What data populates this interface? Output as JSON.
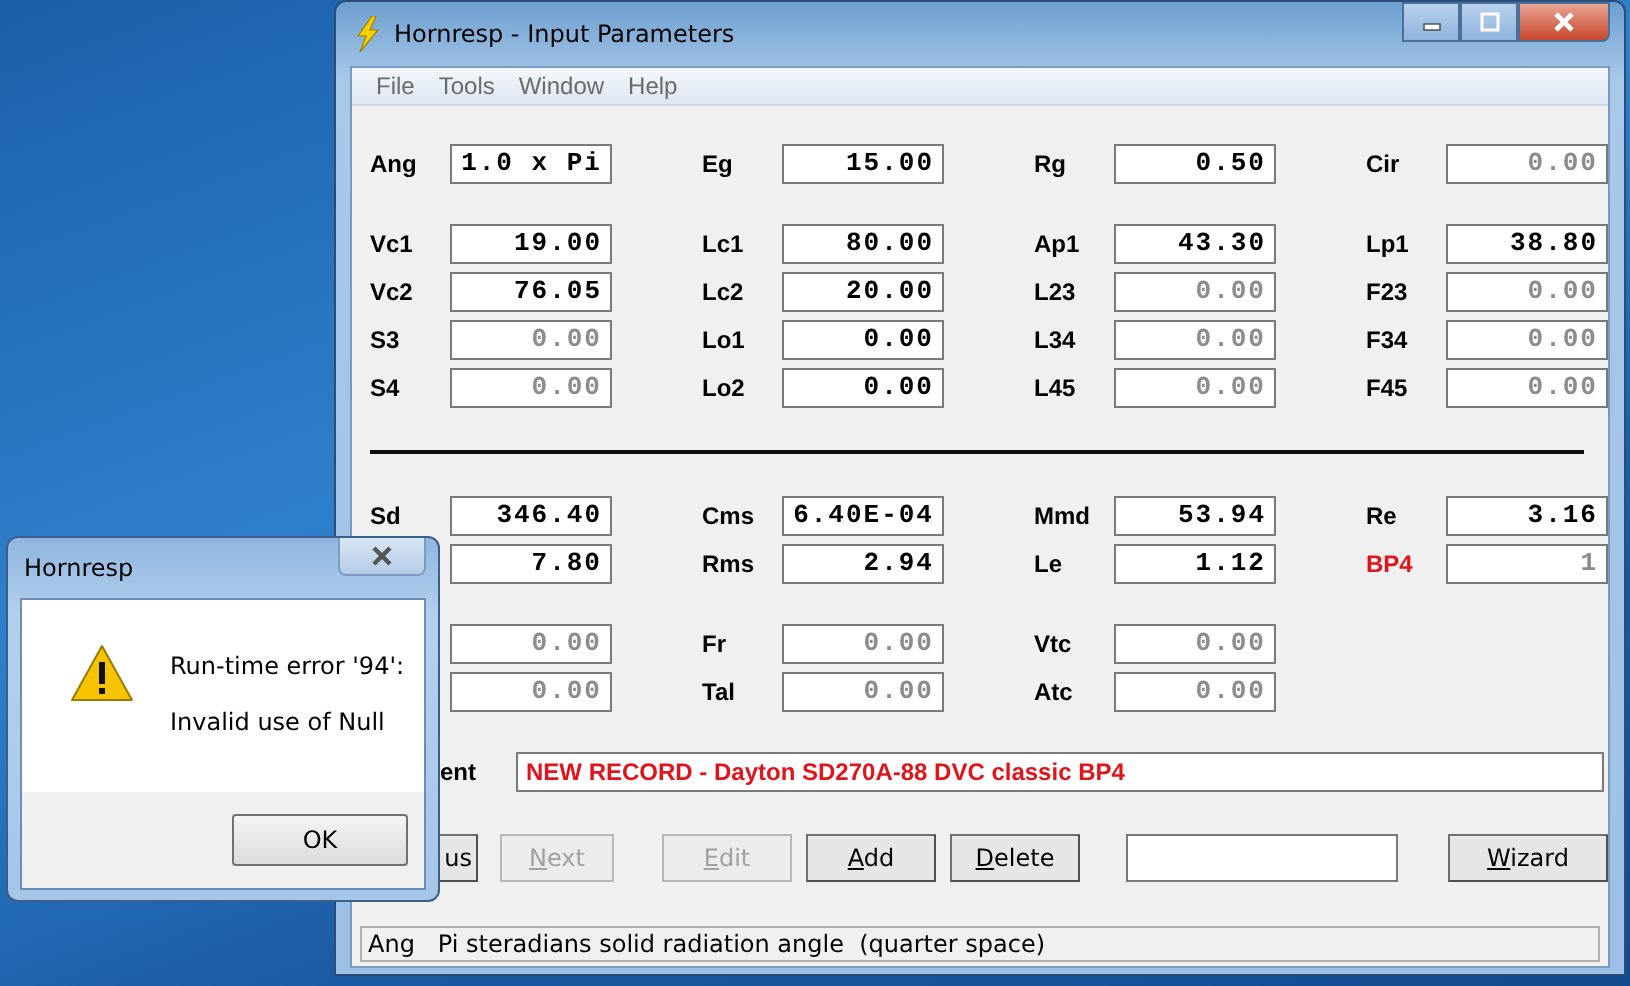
{
  "window": {
    "title": "Hornresp - Input Parameters"
  },
  "menu": [
    "File",
    "Tools",
    "Window",
    "Help"
  ],
  "sections": [
    {
      "groups": [
        [
          [
            {
              "label": "Ang",
              "value": "1.0 x Pi",
              "disabled": false
            },
            {
              "label": "Eg",
              "value": "15.00",
              "disabled": false
            },
            {
              "label": "Rg",
              "value": "0.50",
              "disabled": false
            },
            {
              "label": "Cir",
              "value": "0.00",
              "disabled": true
            }
          ]
        ],
        [
          [
            {
              "label": "Vc1",
              "value": "19.00",
              "disabled": false
            },
            {
              "label": "Lc1",
              "value": "80.00",
              "disabled": false
            },
            {
              "label": "Ap1",
              "value": "43.30",
              "disabled": false
            },
            {
              "label": "Lp1",
              "value": "38.80",
              "disabled": false
            }
          ],
          [
            {
              "label": "Vc2",
              "value": "76.05",
              "disabled": false
            },
            {
              "label": "Lc2",
              "value": "20.00",
              "disabled": false
            },
            {
              "label": "L23",
              "value": "0.00",
              "disabled": true
            },
            {
              "label": "F23",
              "value": "0.00",
              "disabled": true
            }
          ],
          [
            {
              "label": "S3",
              "value": "0.00",
              "disabled": true
            },
            {
              "label": "Lo1",
              "value": "0.00",
              "disabled": false
            },
            {
              "label": "L34",
              "value": "0.00",
              "disabled": true
            },
            {
              "label": "F34",
              "value": "0.00",
              "disabled": true
            }
          ],
          [
            {
              "label": "S4",
              "value": "0.00",
              "disabled": true
            },
            {
              "label": "Lo2",
              "value": "0.00",
              "disabled": false
            },
            {
              "label": "L45",
              "value": "0.00",
              "disabled": true
            },
            {
              "label": "F45",
              "value": "0.00",
              "disabled": true
            }
          ]
        ]
      ]
    },
    {
      "groups": [
        [
          [
            {
              "label": "Sd",
              "value": "346.40",
              "disabled": false
            },
            {
              "label": "Cms",
              "value": "6.40E-04",
              "disabled": false
            },
            {
              "label": "Mmd",
              "value": "53.94",
              "disabled": false
            },
            {
              "label": "Re",
              "value": "3.16",
              "disabled": false
            }
          ],
          [
            {
              "value": "7.80",
              "disabled": false
            },
            {
              "label": "Rms",
              "value": "2.94",
              "disabled": false
            },
            {
              "label": "Le",
              "value": "1.12",
              "disabled": false
            },
            {
              "label": "BP4",
              "value": "1",
              "disabled": true,
              "highlight": true
            }
          ]
        ],
        [
          [
            {
              "value": "0.00",
              "disabled": true
            },
            {
              "label": "Fr",
              "value": "0.00",
              "disabled": true
            },
            {
              "label": "Vtc",
              "value": "0.00",
              "disabled": true
            }
          ],
          [
            {
              "value": "0.00",
              "disabled": true
            },
            {
              "label": "Tal",
              "value": "0.00",
              "disabled": true
            },
            {
              "label": "Atc",
              "value": "0.00",
              "disabled": true
            }
          ]
        ]
      ]
    }
  ],
  "comment": {
    "label": "ent",
    "value": "NEW RECORD - Dayton SD270A-88 DVC classic BP4"
  },
  "buttons": [
    {
      "kind": "button",
      "label": "us",
      "disabled": false,
      "access_key": false
    },
    {
      "kind": "button",
      "label": "Next",
      "disabled": true,
      "access_key": true
    },
    {
      "kind": "button",
      "label": "Edit",
      "disabled": true,
      "access_key": true
    },
    {
      "kind": "button",
      "label": "Add",
      "disabled": false,
      "access_key": true
    },
    {
      "kind": "button",
      "label": "Delete",
      "disabled": false,
      "access_key": true
    },
    {
      "kind": "field"
    },
    {
      "kind": "button",
      "label": "Wizard",
      "disabled": false,
      "access_key": true
    }
  ],
  "status_bar": "Ang   Pi steradians solid radiation angle  (quarter space)",
  "dialog": {
    "title": "Hornresp",
    "lines": [
      "Run-time error '94':",
      "Invalid use of Null"
    ],
    "button": "OK"
  }
}
